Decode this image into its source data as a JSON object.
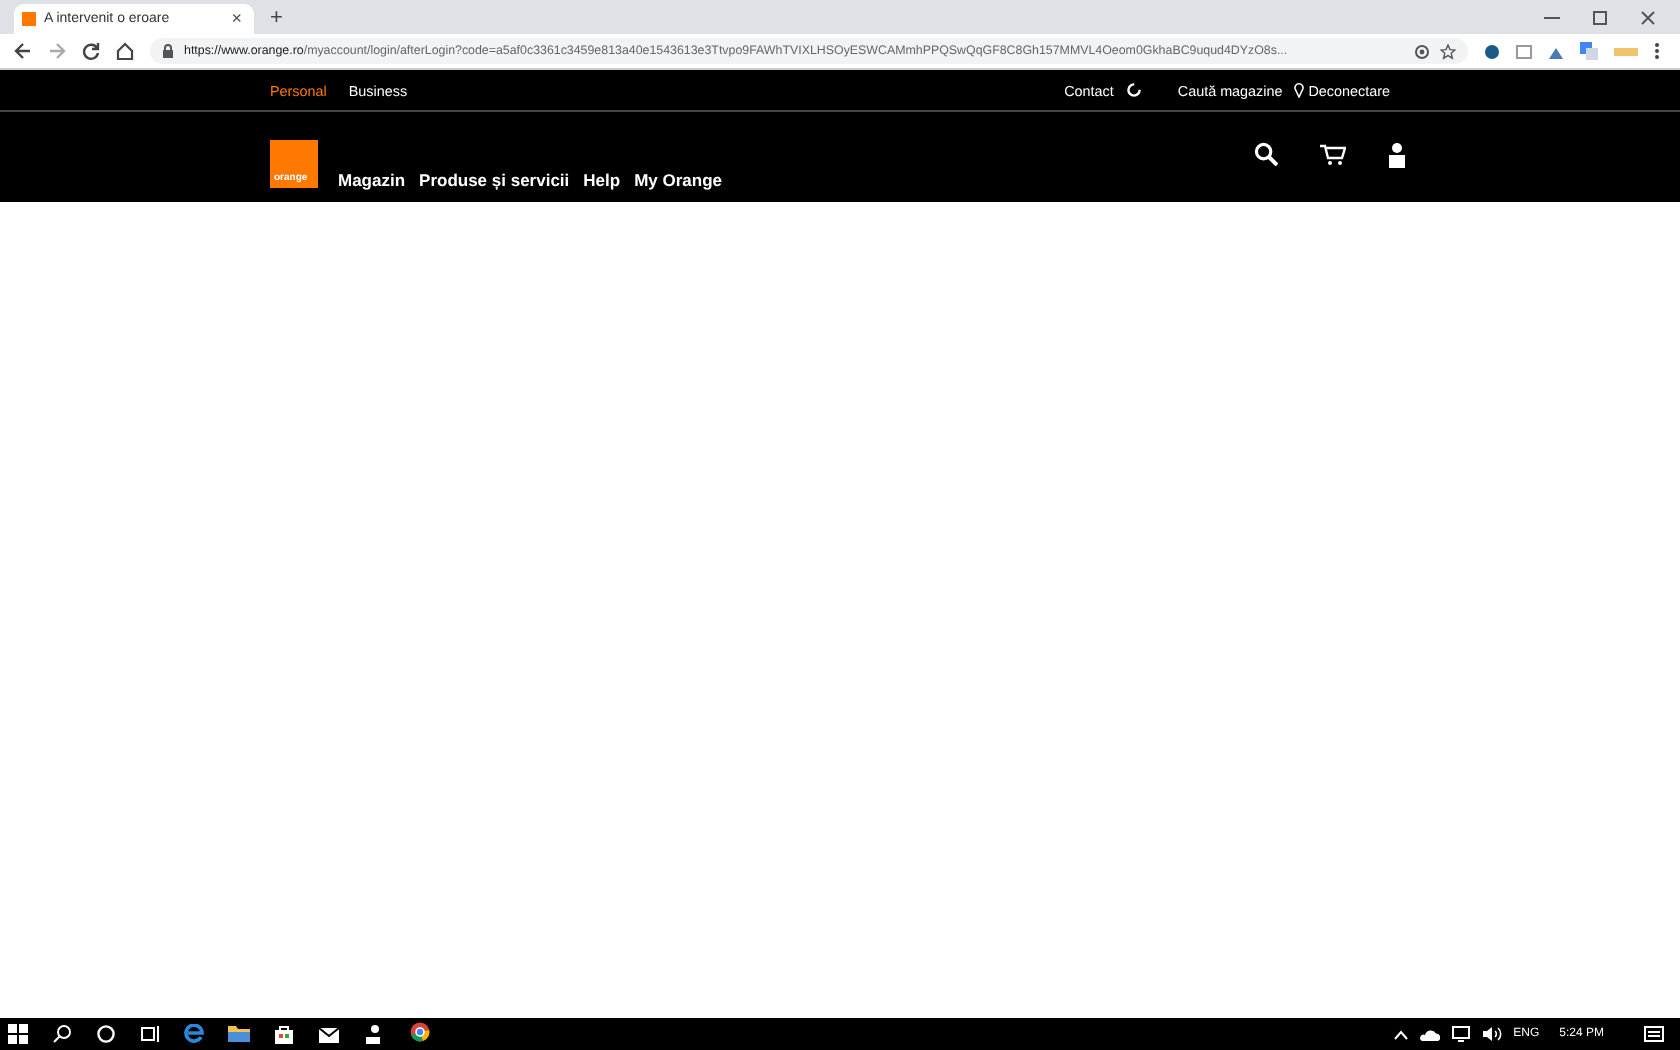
{
  "browser": {
    "tab": {
      "title": "A intervenit o eroare",
      "close": "×"
    },
    "new_tab": "+",
    "url_host": "https://www.orange.ro",
    "url_path": "/myaccount/login/afterLogin?code=a5af0c3361c3459e813a40e1543613e3Ttvpo9FAWhTVIXLHSOyESWCAMmhPPQSwQqGF8C8Gh157MMVL4Oeom0GkhaBC9uqud4DYzO8s..."
  },
  "site": {
    "segments": [
      {
        "label": "Personal",
        "selected": true
      },
      {
        "label": "Business",
        "selected": false
      }
    ],
    "utility_links": [
      {
        "label": "Contact",
        "kind": "contact"
      },
      {
        "label": "Caută magazine",
        "kind": "plain"
      },
      {
        "label": "Deconectare",
        "kind": "pin"
      }
    ],
    "logo": "orange",
    "nav": [
      "Magazin",
      "Produse și servicii",
      "Help",
      "My Orange"
    ]
  },
  "taskbar": {
    "language": "ENG",
    "time": "5:24 PM"
  }
}
